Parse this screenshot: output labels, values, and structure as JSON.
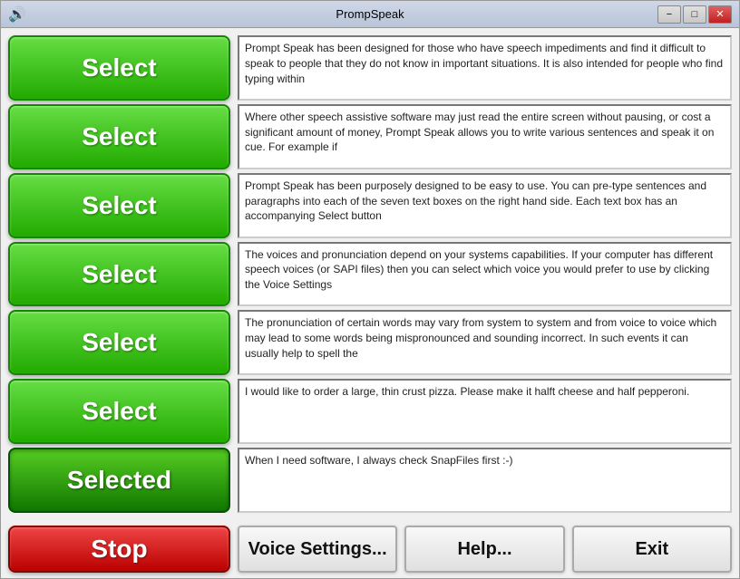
{
  "window": {
    "title": "PrompSpeak",
    "titlebar_icon": "🔊"
  },
  "buttons": {
    "select_label": "Select",
    "selected_label": "Selected",
    "stop_label": "Stop",
    "voice_settings_label": "Voice Settings...",
    "help_label": "Help...",
    "exit_label": "Exit"
  },
  "textboxes": [
    {
      "id": "tb1",
      "content": "Prompt Speak has been designed for those who have speech impediments and find it difficult to speak to people that they do not know in important situations. It is also intended for people who find typing within"
    },
    {
      "id": "tb2",
      "content": "Where other speech assistive software may just read the entire screen without pausing, or cost a significant amount of money, Prompt Speak allows you to write various sentences and speak it on cue. For example if"
    },
    {
      "id": "tb3",
      "content": "Prompt Speak has been purposely designed to be easy to use. You can pre-type sentences and paragraphs into each of the seven text boxes on the right hand side. Each text box has an accompanying Select button"
    },
    {
      "id": "tb4",
      "content": "The voices and pronunciation depend on your systems capabilities. If your computer has different speech voices (or SAPI files) then you can select which voice you would prefer to use by clicking the Voice Settings"
    },
    {
      "id": "tb5",
      "content": "The pronunciation of certain words may vary from system to system and from voice to voice which may lead to some words being mispronounced and sounding incorrect. In such events it can usually help to spell the"
    },
    {
      "id": "tb6",
      "content": "I would like to order a large, thin crust pizza. Please make it halft cheese and half pepperoni."
    },
    {
      "id": "tb7",
      "content": "When I need software, I always check SnapFiles first :-)"
    }
  ],
  "titlebar": {
    "minimize_label": "−",
    "maximize_label": "□",
    "close_label": "✕"
  }
}
